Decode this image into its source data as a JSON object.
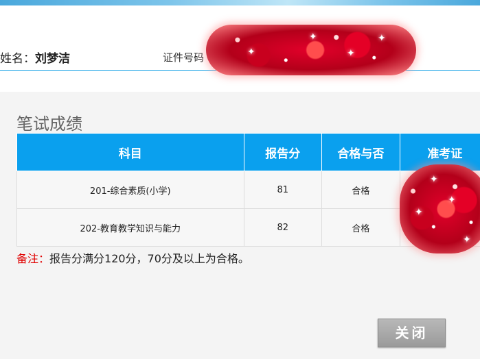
{
  "header": {
    "name_label": "姓名：",
    "name_value": "刘梦洁",
    "id_label": "证件号码"
  },
  "section": {
    "title": "笔试成绩"
  },
  "table": {
    "columns": [
      "科目",
      "报告分",
      "合格与否",
      "准考证"
    ],
    "rows": [
      {
        "subject": "201-综合素质(小学)",
        "score": "81",
        "pass": "合格"
      },
      {
        "subject": "202-教育教学知识与能力",
        "score": "82",
        "pass": "合格"
      }
    ]
  },
  "note": {
    "label": "备注：",
    "text": "报告分满分120分，70分及以上为合格。"
  },
  "buttons": {
    "close": "关闭"
  },
  "colors": {
    "header_bg": "#0aa0ee",
    "note_label": "#e00000",
    "accent_line": "#1aa3e6"
  }
}
